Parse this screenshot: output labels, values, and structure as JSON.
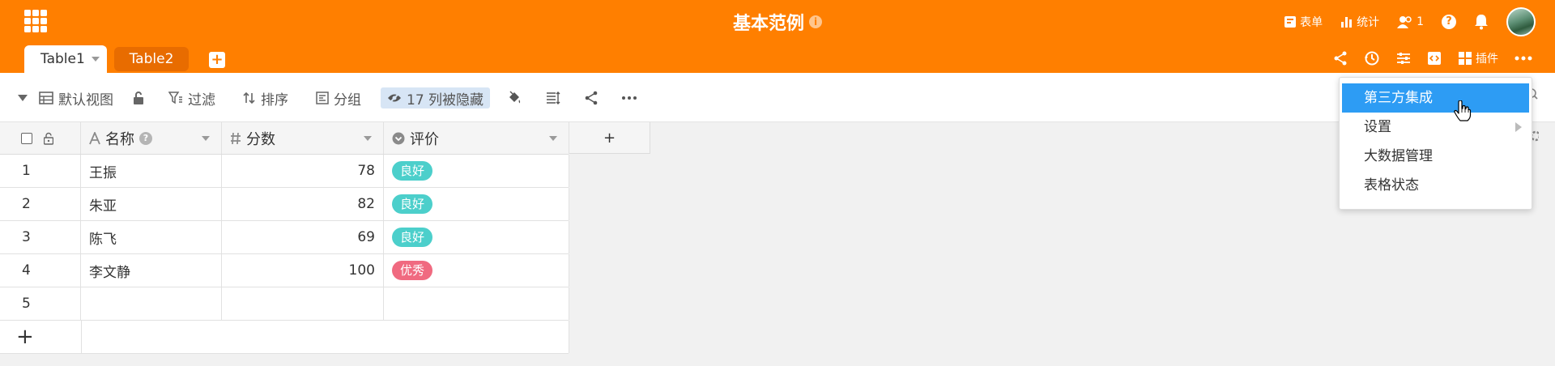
{
  "header": {
    "title": "基本范例",
    "info": "i",
    "actions": [
      {
        "id": "form",
        "label": "表单",
        "icon": "form-icon"
      },
      {
        "id": "stats",
        "label": "统计",
        "icon": "bar-chart-icon"
      },
      {
        "id": "collab",
        "label": "1",
        "icon": "users-icon"
      }
    ],
    "help": "?"
  },
  "tabs": [
    {
      "label": "Table1",
      "active": true
    },
    {
      "label": "Table2",
      "active": false
    }
  ],
  "add_tab": "+",
  "header_tools": {
    "plugins_label": "插件"
  },
  "toolbar": {
    "view_label": "默认视图",
    "filter_label": "过滤",
    "sort_label": "排序",
    "group_label": "分组",
    "hidden_label": "17 列被隐藏"
  },
  "columns": [
    {
      "name": "名称",
      "icon": "text-type-icon",
      "help": "?"
    },
    {
      "name": "分数",
      "icon": "number-type-icon"
    },
    {
      "name": "评价",
      "icon": "single-select-type-icon"
    }
  ],
  "add_column": "+",
  "rows": [
    {
      "index": "1",
      "name": "王振",
      "score": "78",
      "eval": "良好",
      "eval_color": "#4ccfcb"
    },
    {
      "index": "2",
      "name": "朱亚",
      "score": "82",
      "eval": "良好",
      "eval_color": "#4ccfcb"
    },
    {
      "index": "3",
      "name": "陈飞",
      "score": "69",
      "eval": "良好",
      "eval_color": "#4ccfcb"
    },
    {
      "index": "4",
      "name": "李文静",
      "score": "100",
      "eval": "优秀",
      "eval_color": "#f06a80"
    },
    {
      "index": "5",
      "name": "",
      "score": "",
      "eval": "",
      "eval_color": ""
    }
  ],
  "add_row": "+",
  "dropdown": {
    "items": [
      {
        "label": "第三方集成",
        "active": true
      },
      {
        "label": "设置",
        "has_submenu": true
      },
      {
        "label": "大数据管理"
      },
      {
        "label": "表格状态"
      }
    ]
  },
  "colors": {
    "brand": "#ff7f00",
    "menu_highlight": "#2d9cf4",
    "hidden_cols_bg": "#d7e5f5"
  }
}
